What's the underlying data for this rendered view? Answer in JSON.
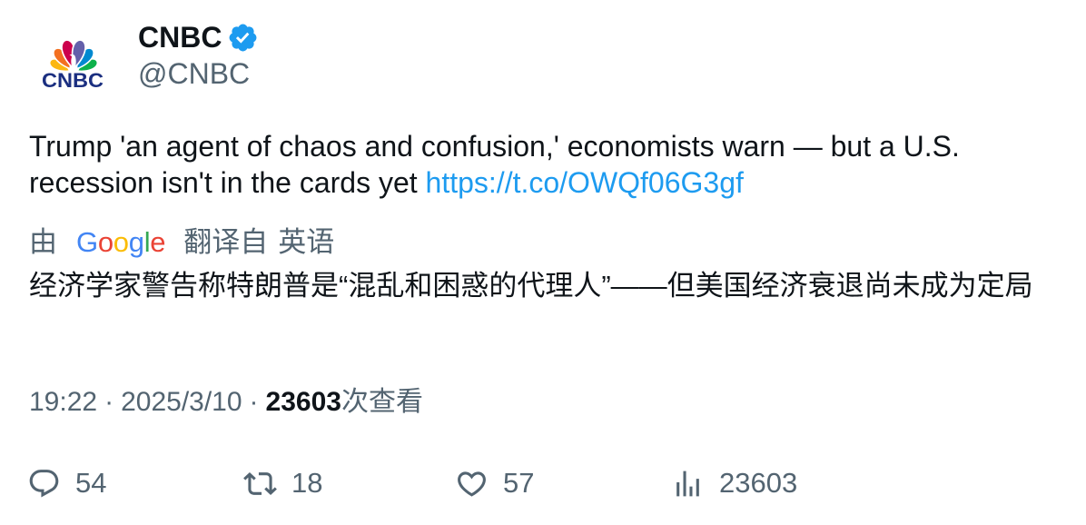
{
  "author": {
    "name": "CNBC",
    "handle": "@CNBC",
    "verified_icon": "verified-badge-icon",
    "avatar_icon": "cnbc-peacock-logo",
    "logo_text": "CNBC"
  },
  "tweet": {
    "text": "Trump 'an agent of chaos and confusion,' economists warn — but a U.S. recession isn't in the cards yet",
    "link": "https://t.co/OWQf06G3gf"
  },
  "translation": {
    "by": "由",
    "provider": "Google",
    "from_label": "翻译自",
    "language": "英语",
    "text": "经济学家警告称特朗普是“混乱和困惑的代理人”——但美国经济衰退尚未成为定局"
  },
  "meta": {
    "time": "19:22",
    "separator": "·",
    "date": "2025/3/10",
    "views_count": "23603",
    "views_label": "次查看"
  },
  "actions": [
    {
      "icon": "reply-icon",
      "count": "54"
    },
    {
      "icon": "retweet-icon",
      "count": "18"
    },
    {
      "icon": "like-icon",
      "count": "57"
    },
    {
      "icon": "views-icon",
      "count": "23603"
    }
  ],
  "colors": {
    "primary_text": "#0f1419",
    "secondary_text": "#536471",
    "link": "#1d9bf0",
    "verified": "#1d9bf0",
    "logo_text": "#1b2f80",
    "google": [
      "#4285F4",
      "#EA4335",
      "#FBBC05",
      "#4285F4",
      "#34A853",
      "#EA4335"
    ],
    "peacock": [
      "#FCB711",
      "#F37021",
      "#CC004C",
      "#6460AA",
      "#0089D0",
      "#0DB14B"
    ]
  }
}
